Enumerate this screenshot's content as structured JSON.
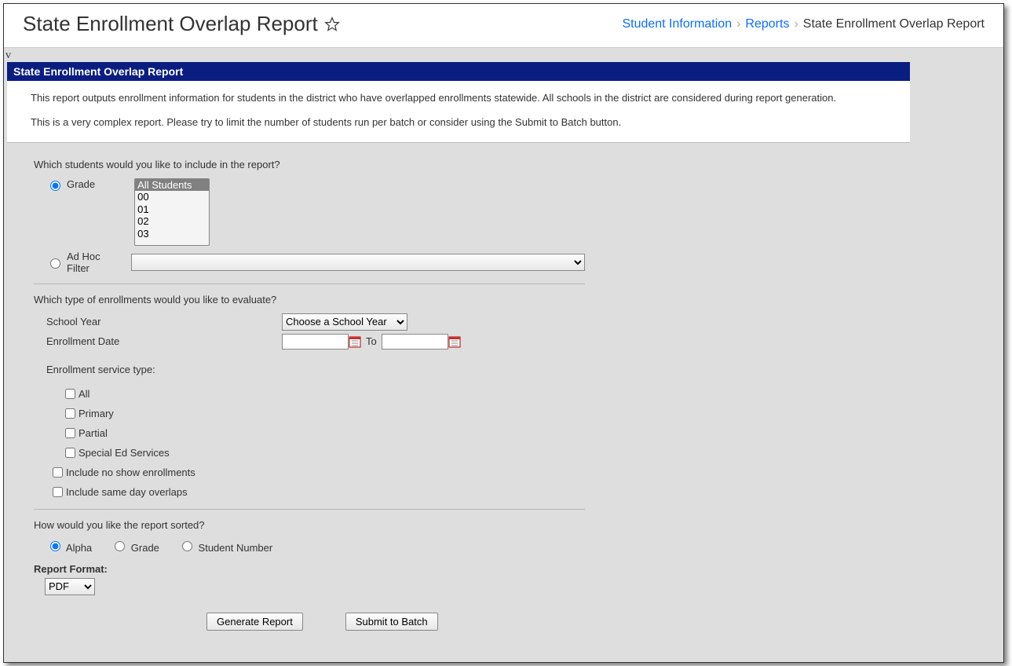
{
  "header": {
    "title": "State Enrollment Overlap Report",
    "breadcrumb": {
      "l1": "Student Information",
      "l2": "Reports",
      "current": "State Enrollment Overlap Report"
    }
  },
  "stray": "v",
  "panel": {
    "title": "State Enrollment Overlap Report",
    "desc1": "This report outputs enrollment information for students in the district who have overlapped enrollments statewide. All schools in the district are considered during report generation.",
    "desc2": "This is a very complex report. Please try to limit the number of students run per batch or consider using the Submit to Batch button."
  },
  "form": {
    "q_students": "Which students would you like to include in the report?",
    "radio_grade": "Grade",
    "grade_options": {
      "o0": "All Students",
      "o1": "00",
      "o2": "01",
      "o3": "02",
      "o4": "03"
    },
    "radio_adhoc": "Ad Hoc Filter",
    "q_enroll": "Which type of enrollments would you like to evaluate?",
    "school_year_label": "School Year",
    "school_year_value": "Choose a School Year",
    "enroll_date_label": "Enrollment Date",
    "to_label": "To",
    "service_type_label": "Enrollment service type:",
    "svc_all": "All",
    "svc_primary": "Primary",
    "svc_partial": "Partial",
    "svc_sped": "Special Ed Services",
    "include_noshow": "Include no show enrollments",
    "include_sameday": "Include same day overlaps",
    "q_sort": "How would you like the report sorted?",
    "sort_alpha": "Alpha",
    "sort_grade": "Grade",
    "sort_sn": "Student Number",
    "format_label": "Report Format:",
    "format_value": "PDF",
    "btn_generate": "Generate Report",
    "btn_batch": "Submit to Batch"
  }
}
